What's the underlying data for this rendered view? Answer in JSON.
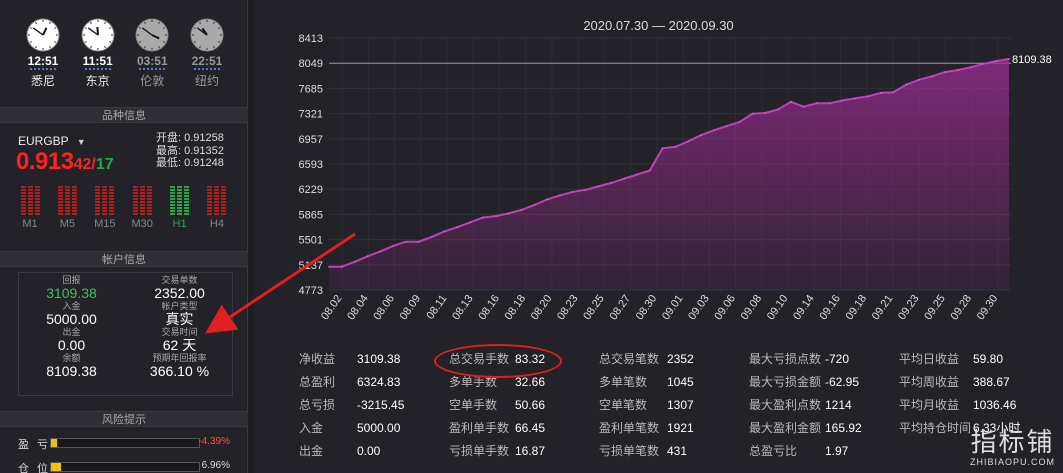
{
  "clocks": [
    {
      "time": "12:51",
      "city": "悉尼",
      "dim": false
    },
    {
      "time": "11:51",
      "city": "东京",
      "dim": false
    },
    {
      "time": "03:51",
      "city": "伦敦",
      "dim": true
    },
    {
      "time": "22:51",
      "city": "纽约",
      "dim": true
    }
  ],
  "sections": {
    "symbol_info": "品种信息",
    "account_info": "帐户信息",
    "risk": "风险提示"
  },
  "symbol": {
    "name": "EURGBP",
    "price_main": "0.913",
    "price_small1": "42",
    "price_small2": "17",
    "open_label": "开盘:",
    "open": "0.91258",
    "high_label": "最高:",
    "high": "0.91352",
    "low_label": "最低:",
    "low": "0.91248"
  },
  "timeframes": [
    {
      "label": "M1",
      "green": false
    },
    {
      "label": "M5",
      "green": false
    },
    {
      "label": "M15",
      "green": false
    },
    {
      "label": "M30",
      "green": false
    },
    {
      "label": "H1",
      "green": true
    },
    {
      "label": "H4",
      "green": false
    }
  ],
  "account": {
    "left": [
      {
        "k": "回报",
        "v": "3109.38",
        "green": true
      },
      {
        "k": "入金",
        "v": "5000.00"
      },
      {
        "k": "出金",
        "v": "0.00"
      },
      {
        "k": "余额",
        "v": "8109.38"
      }
    ],
    "right": [
      {
        "k": "交易单数",
        "v": "2352.00"
      },
      {
        "k": "帐户类型",
        "v": "真实"
      },
      {
        "k": "交易时间",
        "v": "62 天"
      },
      {
        "k": "预期年回报率",
        "v": "366.10 %"
      }
    ]
  },
  "risk": [
    {
      "name": "盈亏",
      "pct": "-4.39%",
      "level": 0.04
    },
    {
      "name": "仓位",
      "pct": "6.96%",
      "level": 0.07
    }
  ],
  "chart_data": {
    "type": "area",
    "title": "2020.07.30 — 2020.09.30",
    "x": [
      "08.02",
      "08.04",
      "08.06",
      "08.09",
      "08.11",
      "08.13",
      "08.16",
      "08.18",
      "08.20",
      "08.23",
      "08.25",
      "08.27",
      "08.30",
      "09.01",
      "09.03",
      "09.06",
      "09.08",
      "09.10",
      "09.14",
      "09.16",
      "09.18",
      "09.21",
      "09.23",
      "09.25",
      "09.28",
      "09.30"
    ],
    "y_ticks": [
      4773,
      5137,
      5501,
      5865,
      6229,
      6593,
      6957,
      7321,
      7685,
      8049,
      8413
    ],
    "ylim": [
      4773,
      8413
    ],
    "last_value_label": "8109.38",
    "reference_line": 8049,
    "values": [
      5110,
      5110,
      5180,
      5260,
      5330,
      5410,
      5470,
      5470,
      5540,
      5620,
      5680,
      5750,
      5820,
      5840,
      5880,
      5930,
      6000,
      6080,
      6140,
      6190,
      6220,
      6270,
      6320,
      6380,
      6440,
      6500,
      6820,
      6840,
      6920,
      7010,
      7080,
      7140,
      7200,
      7320,
      7330,
      7380,
      7490,
      7420,
      7470,
      7470,
      7510,
      7540,
      7570,
      7620,
      7630,
      7740,
      7810,
      7860,
      7920,
      7950,
      7990,
      8040,
      8080,
      8109.38
    ],
    "color": "#9c2c92"
  },
  "stats": [
    [
      {
        "k": "净收益",
        "v": "3109.38"
      },
      {
        "k": "总盈利",
        "v": "6324.83"
      },
      {
        "k": "总亏损",
        "v": "-3215.45"
      },
      {
        "k": "入金",
        "v": "5000.00"
      },
      {
        "k": "出金",
        "v": "0.00"
      }
    ],
    [
      {
        "k": "总交易手数",
        "v": "83.32"
      },
      {
        "k": "多单手数",
        "v": "32.66"
      },
      {
        "k": "空单手数",
        "v": "50.66"
      },
      {
        "k": "盈利单手数",
        "v": "66.45"
      },
      {
        "k": "亏损单手数",
        "v": "16.87"
      }
    ],
    [
      {
        "k": "总交易笔数",
        "v": "2352"
      },
      {
        "k": "多单笔数",
        "v": "1045"
      },
      {
        "k": "空单笔数",
        "v": "1307"
      },
      {
        "k": "盈利单笔数",
        "v": "1921"
      },
      {
        "k": "亏损单笔数",
        "v": "431"
      }
    ],
    [
      {
        "k": "最大亏损点数",
        "v": "-720"
      },
      {
        "k": "最大亏损金额",
        "v": "-62.95"
      },
      {
        "k": "最大盈利点数",
        "v": "1214"
      },
      {
        "k": "最大盈利金额",
        "v": "165.92"
      },
      {
        "k": "总盈亏比",
        "v": "1.97"
      }
    ],
    [
      {
        "k": "平均日收益",
        "v": "59.80"
      },
      {
        "k": "平均周收益",
        "v": "388.67"
      },
      {
        "k": "平均月收益",
        "v": "1036.46"
      },
      {
        "k": "平均持仓时间",
        "v": "6.33小时"
      },
      {
        "k": "",
        "v": ""
      }
    ]
  ],
  "watermark": {
    "big": "指标铺",
    "small": "ZHIBIAOPU.COM"
  },
  "annotation": {
    "arrow_color": "#e02020"
  }
}
